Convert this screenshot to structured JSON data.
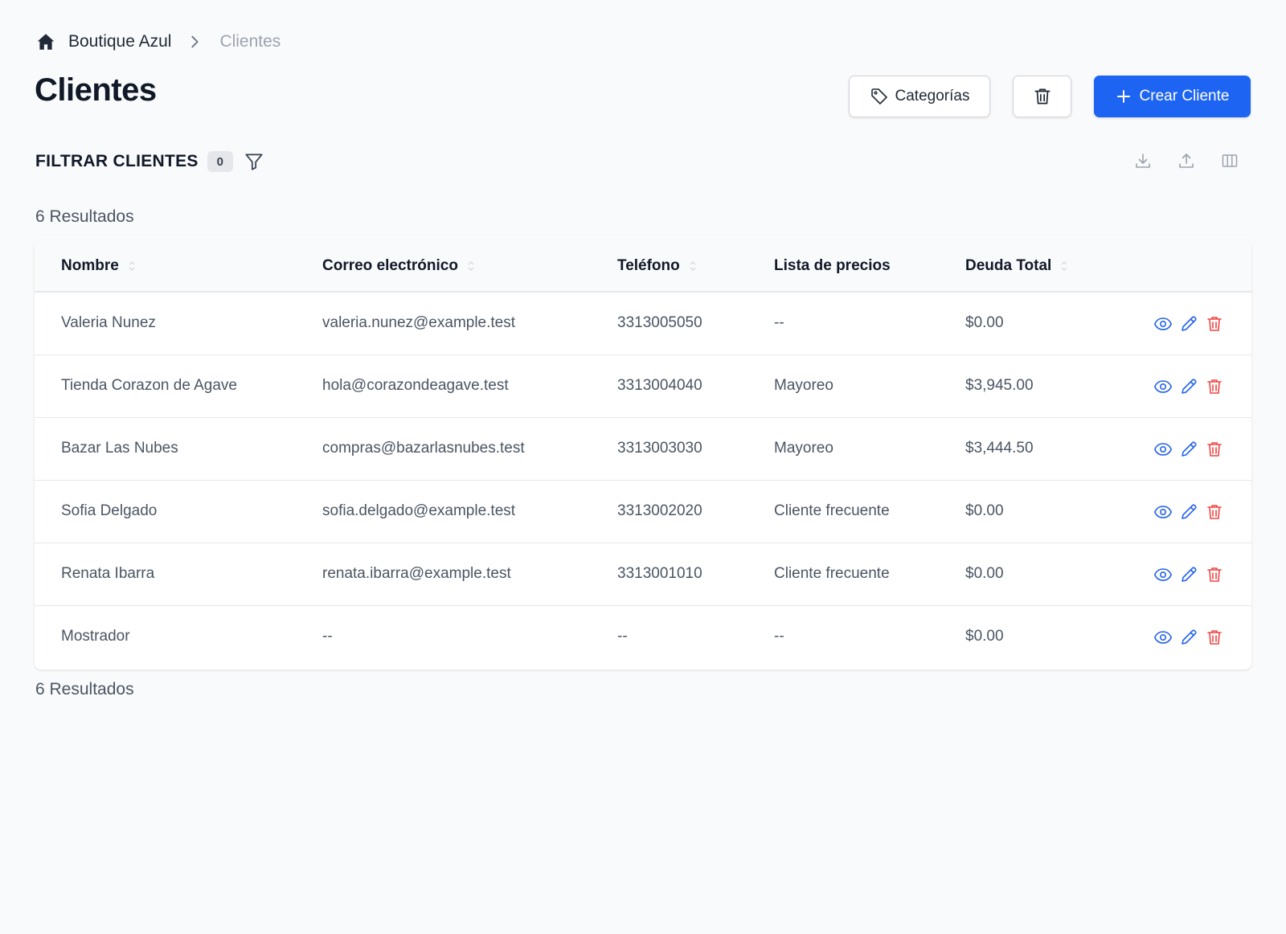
{
  "breadcrumb": {
    "root": "Boutique Azul",
    "current": "Clientes",
    "home_icon": "home-icon",
    "separator_icon": "chevron-right-icon"
  },
  "page": {
    "title": "Clientes"
  },
  "toolbar": {
    "categories_label": "Categorías",
    "categories_icon": "tag-icon",
    "trash_icon": "trash-icon",
    "create_label": "Crear Cliente",
    "create_icon": "plus-icon"
  },
  "filter": {
    "title": "FILTRAR CLIENTES",
    "count": "0",
    "icon": "filter-icon"
  },
  "tools": [
    "download-icon",
    "upload-icon",
    "columns-icon"
  ],
  "results_label": "6 Resultados",
  "table": {
    "headers": {
      "name": "Nombre",
      "email": "Correo electrónico",
      "phone": "Teléfono",
      "price_list": "Lista de precios",
      "debt": "Deuda Total"
    },
    "rows": [
      {
        "name": "Valeria Nunez",
        "email": "valeria.nunez@example.test",
        "phone": "3313005050",
        "price_list": "--",
        "debt": "$0.00"
      },
      {
        "name": "Tienda Corazon de Agave",
        "email": "hola@corazondeagave.test",
        "phone": "3313004040",
        "price_list": "Mayoreo",
        "debt": "$3,945.00"
      },
      {
        "name": "Bazar Las Nubes",
        "email": "compras@bazarlasnubes.test",
        "phone": "3313003030",
        "price_list": "Mayoreo",
        "debt": "$3,444.50"
      },
      {
        "name": "Sofia Delgado",
        "email": "sofia.delgado@example.test",
        "phone": "3313002020",
        "price_list": "Cliente frecuente",
        "debt": "$0.00"
      },
      {
        "name": "Renata Ibarra",
        "email": "renata.ibarra@example.test",
        "phone": "3313001010",
        "price_list": "Cliente frecuente",
        "debt": "$0.00"
      },
      {
        "name": "Mostrador",
        "email": "--",
        "phone": "--",
        "price_list": "--",
        "debt": "$0.00"
      }
    ],
    "row_action_icons": [
      "eye-icon",
      "pencil-icon",
      "trash-icon"
    ]
  },
  "colors": {
    "primary": "#1d64f2",
    "action_blue": "#2563eb",
    "danger": "#ef4444",
    "background": "#f9fafb"
  }
}
